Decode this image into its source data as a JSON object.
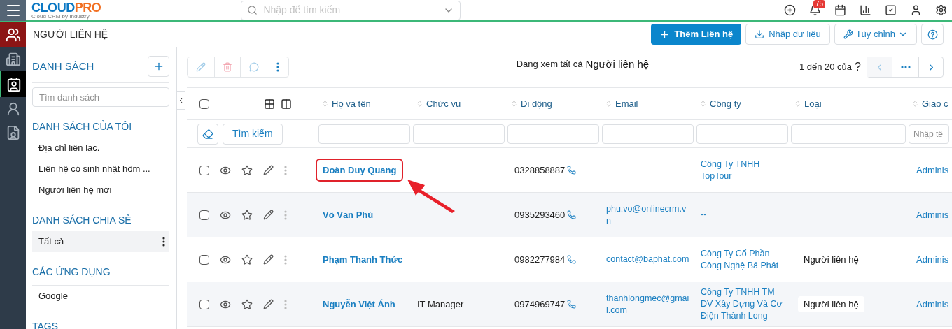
{
  "header": {
    "logo_main": "CLOUD",
    "logo_accent": "PRO",
    "tagline": "Cloud CRM by Industry",
    "search_placeholder": "Nhập để tìm kiếm",
    "notification_badge": "75"
  },
  "rail": [
    {
      "kind": "contacts",
      "selected": false,
      "current_module": true
    },
    {
      "kind": "building",
      "selected": false,
      "current_module": false
    },
    {
      "kind": "contact",
      "selected": true,
      "current_module": false
    },
    {
      "kind": "person",
      "selected": false,
      "current_module": false
    },
    {
      "kind": "card",
      "selected": false,
      "current_module": false
    }
  ],
  "page_title": "NGƯỜI LIÊN HỆ",
  "actions": [
    {
      "kind": "primary",
      "label": "Thêm Liên hệ"
    },
    {
      "kind": "import",
      "label": "Nhập dữ liệu"
    },
    {
      "kind": "customize",
      "label": "Tùy chỉnh"
    },
    {
      "kind": "help"
    }
  ],
  "lists_panel": {
    "title": "DANH SÁCH",
    "search_placeholder": "Tìm danh sách",
    "sections": [
      {
        "title": "DANH SÁCH CỦA TÔI",
        "items": [
          {
            "label": "Địa chỉ liên lạc.",
            "selected": false
          },
          {
            "label": "Liên hệ có sinh nhật hôm ...",
            "selected": false
          },
          {
            "label": "Người liên hệ mới",
            "selected": false
          }
        ]
      },
      {
        "title": "DANH SÁCH CHIA SẺ",
        "items": [
          {
            "label": "Tất cả",
            "selected": true
          }
        ]
      },
      {
        "title": "CÁC ỨNG DỤNG",
        "items": [
          {
            "label": "Google",
            "selected": false
          }
        ]
      },
      {
        "title": "TAGS"
      }
    ]
  },
  "view": {
    "label": "Đang xem tất cả",
    "name": "Người liên hệ",
    "pager": "1 đến 20 của",
    "pager_total": "?"
  },
  "table": {
    "columns": [
      "Họ và tên",
      "Chức vụ",
      "Di động",
      "Email",
      "Công ty",
      "Loại",
      "Giao c"
    ],
    "select_all_checked": false,
    "search_button": "Tìm kiếm",
    "last_filter_placeholder": "Nhập tê",
    "rows": [
      {
        "name": "Đoàn Duy Quang",
        "title": "",
        "mobile": "0328858887",
        "email": "",
        "company": "Công Ty TNHH TopTour",
        "type": "",
        "assignee": "Adminis",
        "highlighted": true,
        "checked": false
      },
      {
        "name": "Võ Văn Phú",
        "title": "",
        "mobile": "0935293460",
        "email": "phu.vo@onlinecrm.vn",
        "company": "--",
        "type": "",
        "assignee": "Adminis",
        "highlighted": false,
        "checked": false
      },
      {
        "name": "Phạm Thanh Thức",
        "title": "",
        "mobile": "0982277984",
        "email": "contact@baphat.com",
        "company": "Công Ty Cổ Phần Công Nghệ Bá Phát",
        "type": "Người liên hệ",
        "assignee": "Adminis",
        "highlighted": false,
        "checked": false
      },
      {
        "name": "Nguyễn Việt Ánh",
        "title": "IT Manager",
        "mobile": "0974969747",
        "email": "thanhlongmec@gmail.com",
        "company": "Công Ty TNHH TM DV Xây Dựng Và Cơ Điện Thành Long",
        "type": "Người liên hệ",
        "assignee": "Adminis",
        "highlighted": false,
        "checked": false
      }
    ]
  }
}
